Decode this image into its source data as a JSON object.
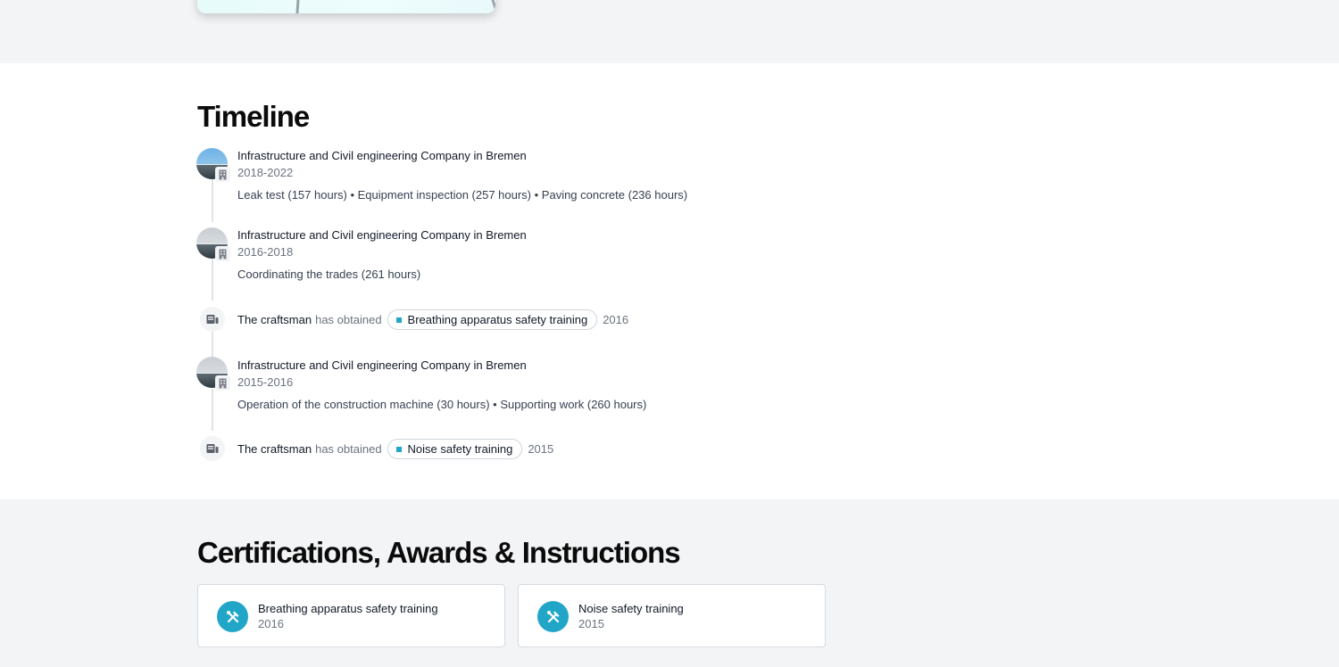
{
  "timeline": {
    "title": "Timeline",
    "entries": [
      {
        "company": "Infrastructure and Civil engineering Company in Bremen",
        "years": "2018-2022",
        "details": "Leak test (157 hours) • Equipment inspection (257 hours) • Paving concrete (236 hours)"
      },
      {
        "company": "Infrastructure and Civil engineering Company in Bremen",
        "years": "2016-2018",
        "details": "Coordinating the trades (261 hours)"
      },
      {
        "actor": "The craftsman",
        "verb": "has obtained",
        "training": "Breathing apparatus safety training",
        "year": "2016"
      },
      {
        "company": "Infrastructure and Civil engineering Company in Bremen",
        "years": "2015-2016",
        "details": "Operation of the construction machine (30 hours) • Supporting work (260 hours)"
      },
      {
        "actor": "The craftsman",
        "verb": "has obtained",
        "training": "Noise safety training",
        "year": "2015"
      }
    ]
  },
  "certifications": {
    "title": "Certifications, Awards & Instructions",
    "items": [
      {
        "name": "Breathing apparatus safety training",
        "year": "2016",
        "icon": "tools-icon"
      },
      {
        "name": "Noise safety training",
        "year": "2015",
        "icon": "tools-icon"
      }
    ]
  },
  "colors": {
    "accent": "#22a6c8",
    "section_gray": "#f3f4f6",
    "section_white": "#ffffff"
  }
}
